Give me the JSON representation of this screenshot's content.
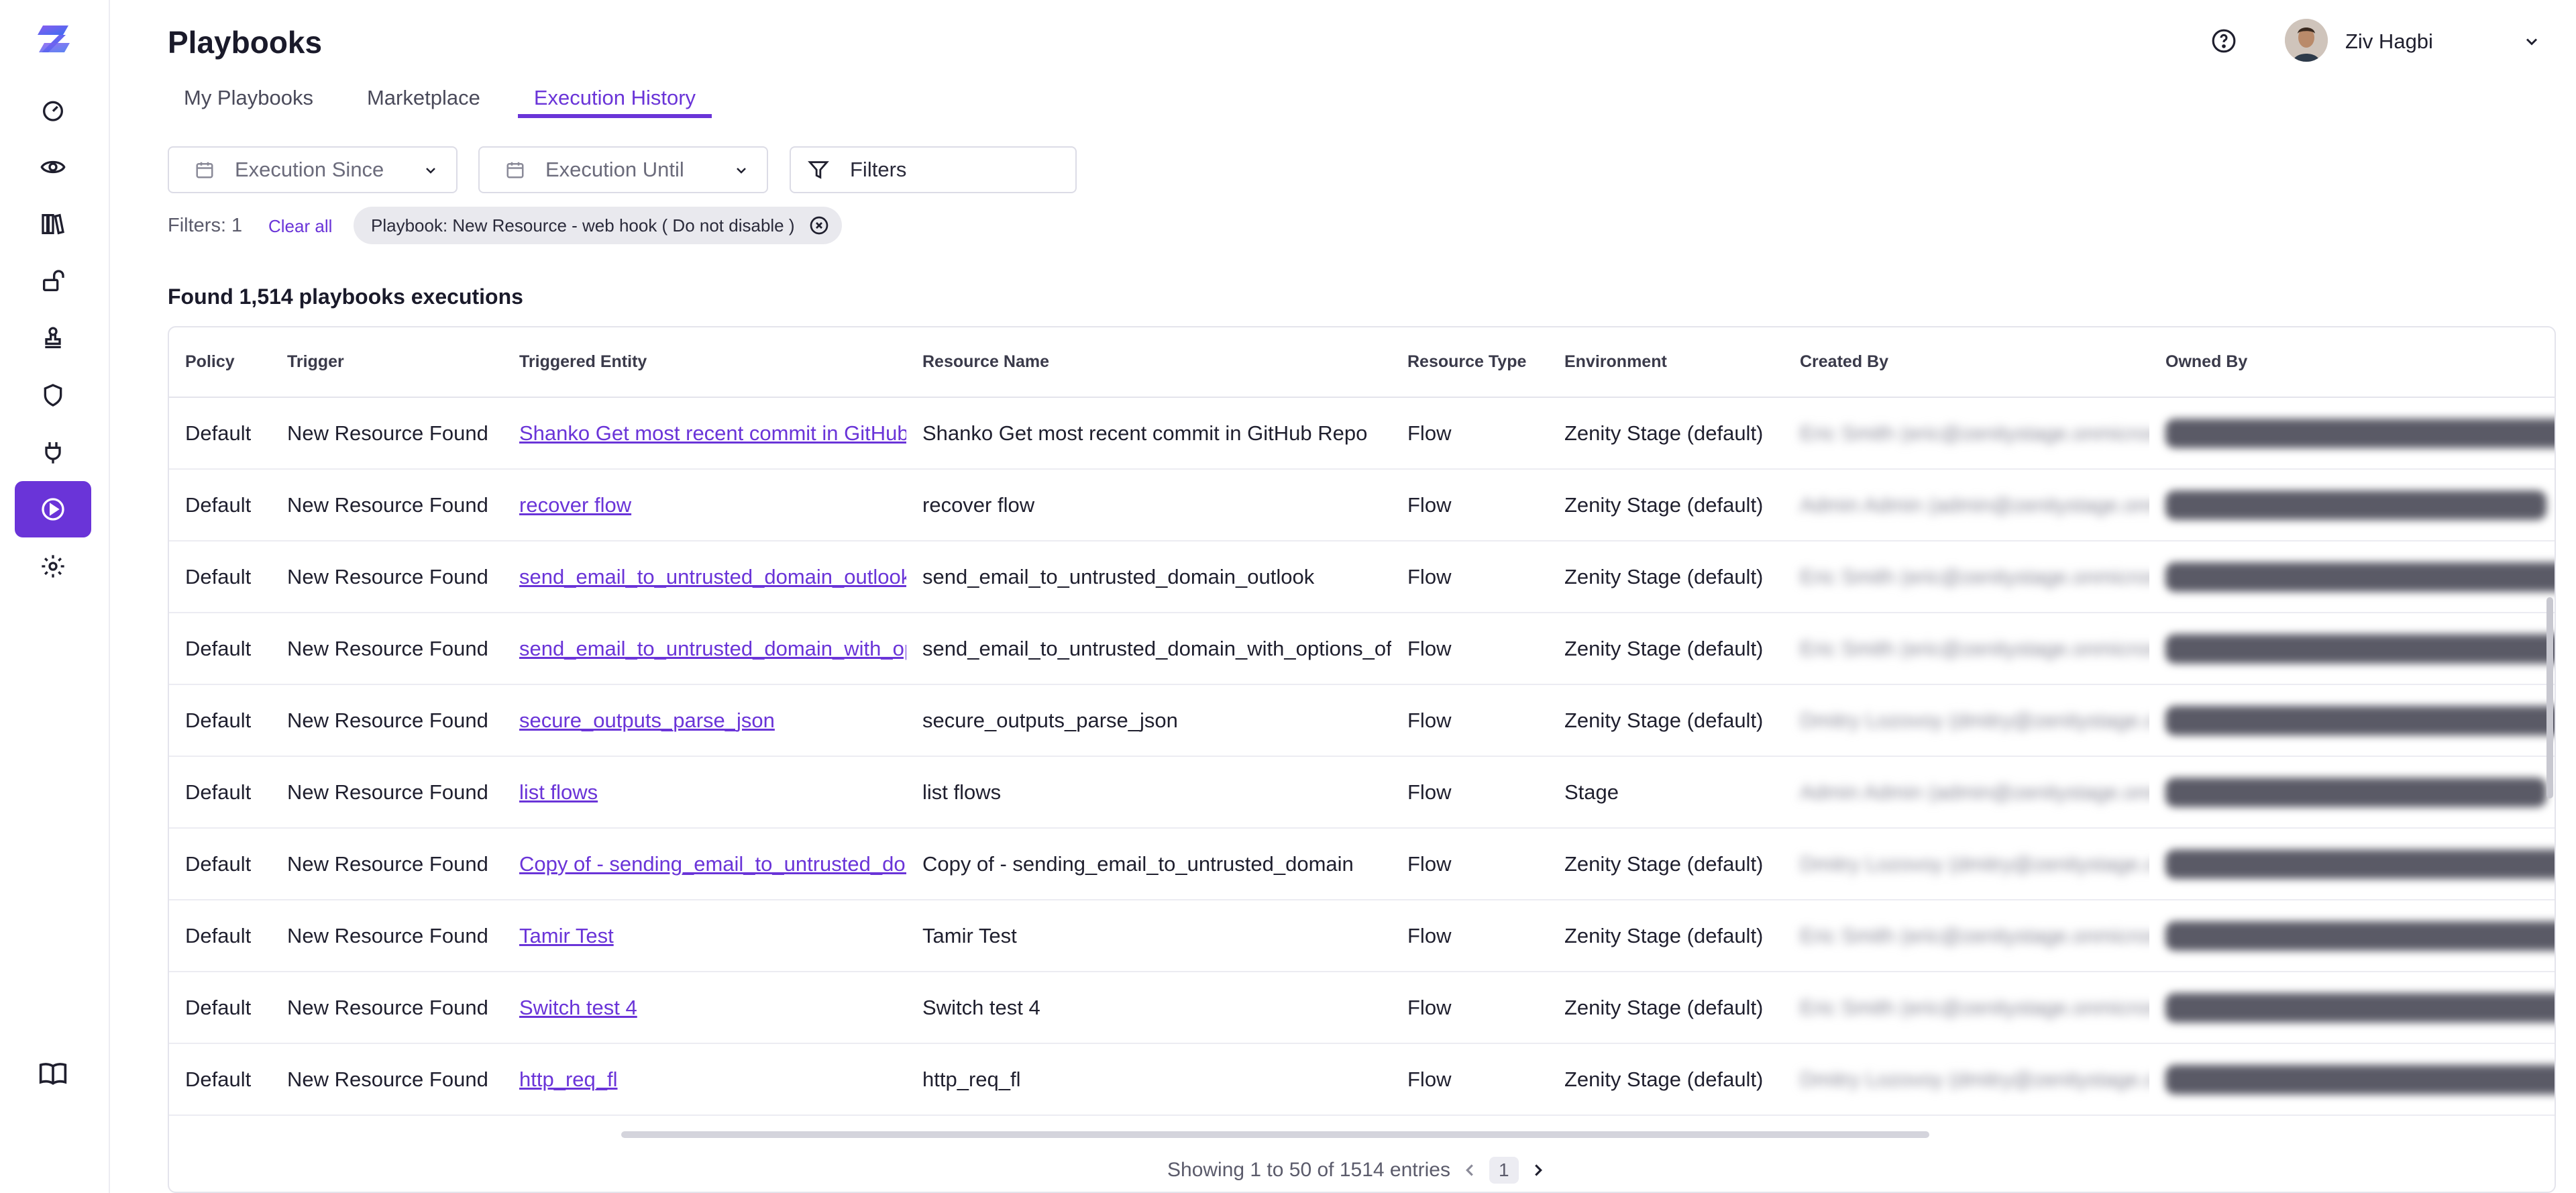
{
  "app": {
    "title": "Playbooks",
    "user_name": "Ziv Hagbi",
    "accent": "#6a34d8"
  },
  "sidebar": {
    "items": [
      {
        "icon": "dashboard-icon"
      },
      {
        "icon": "eye-icon"
      },
      {
        "icon": "library-icon"
      },
      {
        "icon": "unlock-icon"
      },
      {
        "icon": "stamp-icon"
      },
      {
        "icon": "shield-icon"
      },
      {
        "icon": "plug-icon"
      },
      {
        "icon": "playbooks-icon",
        "active": true
      },
      {
        "icon": "gear-icon"
      }
    ],
    "bottom_icon": "book-icon"
  },
  "tabs": [
    {
      "label": "My Playbooks"
    },
    {
      "label": "Marketplace"
    },
    {
      "label": "Execution History",
      "active": true
    }
  ],
  "filters": {
    "execution_since": "Execution Since",
    "execution_until": "Execution Until",
    "filters_button": "Filters",
    "count_text": "Filters: 1",
    "clear_all": "Clear all",
    "chip": "Playbook: New Resource - web hook ( Do not disable )"
  },
  "found_text": "Found 1,514 playbooks executions",
  "table": {
    "headers": [
      "Policy",
      "Trigger",
      "Triggered Entity",
      "Resource Name",
      "Resource Type",
      "Environment",
      "Created By",
      "Owned By"
    ],
    "rows": [
      [
        "Default",
        "New Resource Found",
        "Shanko Get most recent commit in GitHub Repo",
        "Shanko Get most recent commit in GitHub Repo",
        "Flow",
        "Zenity Stage (default)",
        "Eric Smith (eric@zenitystage.onmicrosoft.com)",
        "Eric Smith (eric@zenitystage.onmicrosoft.com)"
      ],
      [
        "Default",
        "New Resource Found",
        "recover flow",
        "recover flow",
        "Flow",
        "Zenity Stage (default)",
        "Admin Admin (admin@zenitystage.onmicrosoft.com)",
        "Admin Admin (admin@zenitystage.com)"
      ],
      [
        "Default",
        "New Resource Found",
        "send_email_to_untrusted_domain_outlook",
        "send_email_to_untrusted_domain_outlook",
        "Flow",
        "Zenity Stage (default)",
        "Eric Smith (eric@zenitystage.onmicrosoft.com)",
        "Eric Smith (eric@zenitystage.onmicrosoft.com)"
      ],
      [
        "Default",
        "New Resource Found",
        "send_email_to_untrusted_domain_with_options_ofc",
        "send_email_to_untrusted_domain_with_options_ofc",
        "Flow",
        "Zenity Stage (default)",
        "Eric Smith (eric@zenitystage.onmicrosoft.com)",
        "Eric Smith (eric@zenitystage.onmicrosoft.com)"
      ],
      [
        "Default",
        "New Resource Found",
        "secure_outputs_parse_json",
        "secure_outputs_parse_json",
        "Flow",
        "Zenity Stage (default)",
        "Dmitry Lozovoy (dmitry@zenitystage.com)",
        "Dmitry Lozovoy (dmitry@zenitystage.com)"
      ],
      [
        "Default",
        "New Resource Found",
        "list flows",
        "list flows",
        "Flow",
        "Stage",
        "Admin Admin (admin@zenitystage.onmicrosoft.com)",
        "Admin Admin (admin@zenitystage.com)"
      ],
      [
        "Default",
        "New Resource Found",
        "Copy of - sending_email_to_untrusted_domain",
        "Copy of - sending_email_to_untrusted_domain",
        "Flow",
        "Zenity Stage (default)",
        "Dmitry Lozovoy (dmitry@zenitystage.com)",
        "Dmitry Lozovoy (dmitry@zenitystage.com)"
      ],
      [
        "Default",
        "New Resource Found",
        "Tamir Test",
        "Tamir Test",
        "Flow",
        "Zenity Stage (default)",
        "Eric Smith (eric@zenitystage.onmicrosoft.com)",
        "Eric Smith (eric@zenitystage.onmicrosoft.com)"
      ],
      [
        "Default",
        "New Resource Found",
        "Switch test 4",
        "Switch test 4",
        "Flow",
        "Zenity Stage (default)",
        "Eric Smith (eric@zenitystage.onmicrosoft.com)",
        "Eric Smith (eric@zenitystage.onmicrosoft.com)"
      ],
      [
        "Default",
        "New Resource Found",
        "http_req_fl",
        "http_req_fl",
        "Flow",
        "Zenity Stage (default)",
        "Dmitry Lozovoy (dmitry@zenitystage.com)",
        "Dmitry Lozovoy (dmitry@zenitystage.com)"
      ]
    ]
  },
  "pagination": {
    "showing": "Showing 1 to 50 of 1514 entries",
    "current_page": "1"
  }
}
